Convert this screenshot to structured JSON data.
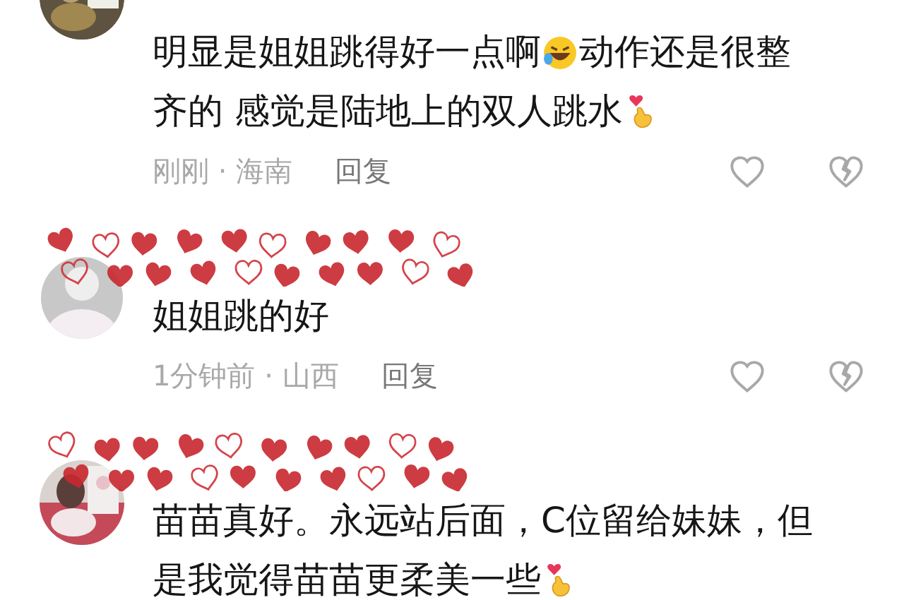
{
  "comments": [
    {
      "avatar": {
        "kind": "picture"
      },
      "lines": [
        [
          {
            "kind": "text",
            "text": "明显是姐姐跳得好一点啊"
          },
          {
            "kind": "laugh-emoji"
          },
          {
            "kind": "text",
            "text": "动作还是很整"
          }
        ],
        [
          {
            "kind": "text",
            "text": "齐的 感觉是陆地上的双人跳水"
          },
          {
            "kind": "finger-heart-emoji"
          }
        ]
      ],
      "meta": "刚刚 · 海南",
      "reply": "回复",
      "liked": false,
      "disliked": false
    },
    {
      "avatar": {
        "kind": "default"
      },
      "name": {
        "kind": "hearts"
      },
      "lines": [
        [
          {
            "kind": "text",
            "text": "姐姐跳的好"
          }
        ]
      ],
      "meta": "1分钟前 · 山西",
      "reply": "回复",
      "liked": false,
      "disliked": false
    },
    {
      "avatar": {
        "kind": "picture"
      },
      "name": {
        "kind": "hearts"
      },
      "lines": [
        [
          {
            "kind": "text",
            "text": "苗苗真好。永远站后面，C位留给妹妹，但"
          }
        ],
        [
          {
            "kind": "text",
            "text": "是我觉得苗苗更柔美一些"
          },
          {
            "kind": "finger-heart-emoji"
          }
        ]
      ]
    }
  ]
}
